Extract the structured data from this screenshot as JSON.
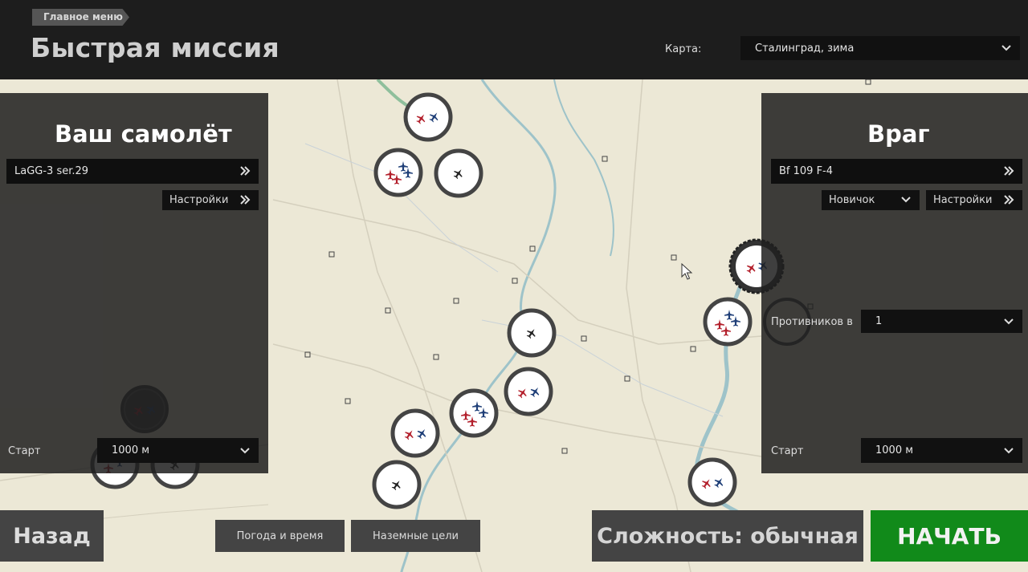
{
  "header": {
    "breadcrumb": "Главное меню",
    "title": "Быстрая миссия",
    "map_label": "Карта:",
    "map_value": "Сталинград, зима"
  },
  "left_panel": {
    "title": "Ваш самолёт",
    "aircraft": "LaGG-3 ser.29",
    "settings_label": "Настройки",
    "start_label": "Старт",
    "start_value": "1000 м"
  },
  "right_panel": {
    "title": "Враг",
    "aircraft": "Bf 109 F-4",
    "skill_value": "Новичок",
    "settings_label": "Настройки",
    "enemies_label": "Противников в",
    "enemies_value": "1",
    "start_label": "Старт",
    "start_value": "1000 м"
  },
  "bottom": {
    "back_label": "Назад",
    "weather_label": "Погода и время",
    "ground_label": "Наземные цели",
    "difficulty_label": "Сложность: обычная",
    "start_label": "НАЧАТЬ"
  },
  "colors": {
    "start_green": "#118a1a",
    "map_bg": "#ece8d6",
    "red_plane": "#b3202c",
    "blue_plane": "#1f3f78"
  },
  "icons": {
    "chevron": "chevron-down-icon",
    "double_chevron": "double-chevron-right-icon",
    "airfield": "airfield-icon"
  }
}
